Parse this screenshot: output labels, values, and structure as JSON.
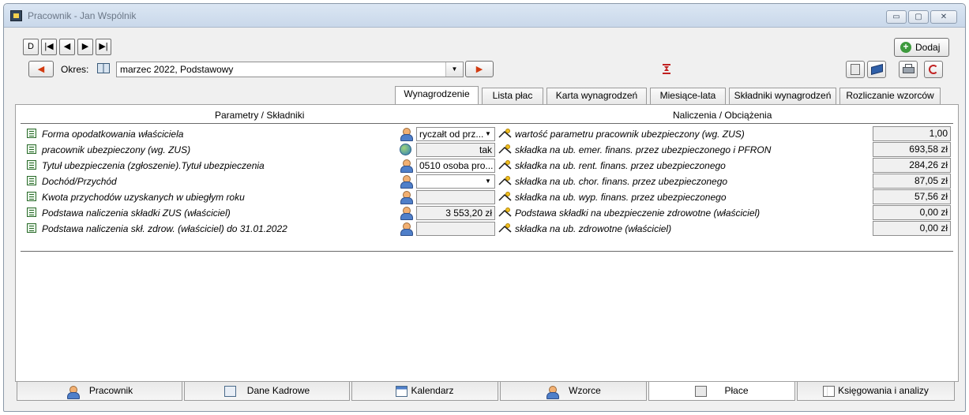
{
  "window": {
    "title": "Pracownik - Jan Wspólnik",
    "controls": [
      "minimize",
      "maximize",
      "close"
    ]
  },
  "toolbar": {
    "nav_buttons": [
      "D",
      "|◀",
      "◀",
      "▶",
      "▶|"
    ],
    "add_label": "Dodaj",
    "period_label": "Okres:",
    "period_value": "marzec 2022, Podstawowy"
  },
  "top_tabs": [
    {
      "label": "Wynagrodzenie",
      "active": true
    },
    {
      "label": "Lista płac",
      "active": false
    },
    {
      "label": "Karta wynagrodzeń",
      "active": false
    },
    {
      "label": "Miesiące-lata",
      "active": false
    },
    {
      "label": "Składniki wynagrodzeń",
      "active": false
    },
    {
      "label": "Rozliczanie wzorców",
      "active": false
    }
  ],
  "grid": {
    "left_header": "Parametry / Składniki",
    "right_header": "Naliczenia / Obciążenia",
    "rows": [
      {
        "left": "Forma opodatkowania właściciela",
        "value": "ryczałt od prz...",
        "right": "wartość parametru pracownik ubezpieczony (wg. ZUS)",
        "amount": "1,00"
      },
      {
        "left": "pracownik ubezpieczony (wg. ZUS)",
        "value": "tak",
        "right": "składka na ub. emer. finans. przez ubezpieczonego i PFRON",
        "amount": "693,58 zł"
      },
      {
        "left": "Tytuł ubezpieczenia (zgłoszenie).Tytuł ubezpieczenia",
        "value": "0510 osoba pro...",
        "right": "składka na ub. rent. finans. przez ubezpieczonego",
        "amount": "284,26 zł"
      },
      {
        "left": "Dochód/Przychód",
        "value": "",
        "right": "składka na ub. chor. finans. przez ubezpieczonego",
        "amount": "87,05 zł"
      },
      {
        "left": "Kwota przychodów uzyskanych w ubiegłym roku",
        "value": "",
        "right": "składka na ub. wyp. finans. przez ubezpieczonego",
        "amount": "57,56 zł"
      },
      {
        "left": "Podstawa naliczenia składki ZUS (właściciel)",
        "value": "3 553,20 zł",
        "right": "Podstawa składki na ubezpieczenie zdrowotne (właściciel)",
        "amount": "0,00 zł"
      },
      {
        "left": "Podstawa naliczenia skł. zdrow. (właściciel) do 31.01.2022",
        "value": "",
        "right": "składka na ub. zdrowotne (właściciel)",
        "amount": "0,00 zł"
      }
    ]
  },
  "bottom_tabs": [
    {
      "label": "Pracownik",
      "active": false
    },
    {
      "label": "Dane Kadrowe",
      "active": false
    },
    {
      "label": "Kalendarz",
      "active": false
    },
    {
      "label": "Wzorce",
      "active": false
    },
    {
      "label": "Płace",
      "active": true
    },
    {
      "label": "Księgowania i analizy",
      "active": false
    }
  ]
}
